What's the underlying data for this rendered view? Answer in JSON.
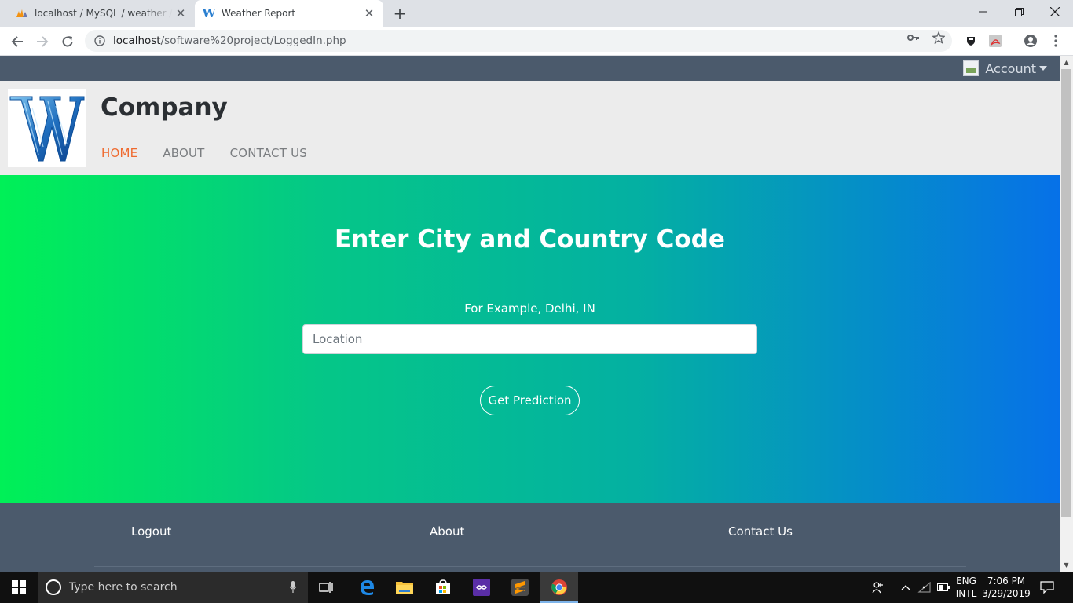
{
  "browser": {
    "tabs": [
      {
        "title": "localhost / MySQL / weather / login",
        "active": false,
        "icon": "phpmyadmin-icon"
      },
      {
        "title": "Weather Report",
        "active": true,
        "icon": "w-logo-icon"
      }
    ],
    "url_host": "localhost",
    "url_path": "/software%20project/LoggedIn.php"
  },
  "page": {
    "account_label": "Account",
    "brand": "Company",
    "nav": [
      {
        "label": "HOME",
        "current": true
      },
      {
        "label": "ABOUT",
        "current": false
      },
      {
        "label": "CONTACT US",
        "current": false
      }
    ],
    "hero": {
      "title": "Enter City and Country Code",
      "hint": "For Example, Delhi, IN",
      "location_placeholder": "Location",
      "location_value": "",
      "submit_label": "Get Prediction"
    },
    "footer": {
      "logout": "Logout",
      "about": "About",
      "contact": "Contact Us"
    },
    "colors": {
      "topbar": "#4b5a6c",
      "nav_active": "#ef6a2f",
      "gradient_start": "#00f057",
      "gradient_end": "#0671e8"
    }
  },
  "taskbar": {
    "search_placeholder": "Type here to search",
    "lang_top": "ENG",
    "lang_bottom": "INTL",
    "time": "7:06 PM",
    "date": "3/29/2019"
  }
}
